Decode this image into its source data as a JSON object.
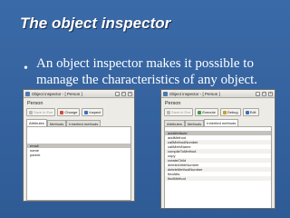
{
  "slide": {
    "title": "The object inspector",
    "bullet": "An object inspector makes it possible to manage the characteristics of any object.",
    "bullet_marker": "•"
  },
  "window1": {
    "title": "Object inspector - [ Person ]",
    "object_name": "Person",
    "toolbar": [
      {
        "label": "Save in Exe",
        "icon": "save-icon",
        "enabled": false
      },
      {
        "label": "Change",
        "icon": "change-icon",
        "enabled": true
      },
      {
        "label": "Inspect",
        "icon": "inspect-icon",
        "enabled": true
      }
    ],
    "tabs": [
      {
        "label": "Attributes",
        "active": true
      },
      {
        "label": "Methods",
        "active": false
      },
      {
        "label": "Inherited methods",
        "active": false
      }
    ],
    "attributes": [
      {
        "name": "email",
        "selected": true
      },
      {
        "name": "name",
        "selected": false
      },
      {
        "name": "parent",
        "selected": false
      }
    ]
  },
  "window2": {
    "title": "Object inspector - [ Person ]",
    "object_name": "Person",
    "toolbar": [
      {
        "label": "Save in Exe",
        "icon": "save-icon",
        "enabled": false
      },
      {
        "label": "Execute",
        "icon": "execute-icon",
        "enabled": true
      },
      {
        "label": "Debug",
        "icon": "debug-icon",
        "enabled": true
      },
      {
        "label": "Edit",
        "icon": "edit-icon",
        "enabled": true
      }
    ],
    "tabs": [
      {
        "label": "Attributes",
        "active": false
      },
      {
        "label": "Methods",
        "active": false
      },
      {
        "label": "Inherited methods",
        "active": true
      }
    ],
    "methods": [
      "addAttribute",
      "addMethod",
      "callMethodNumber",
      "callMethName",
      "compileToMethod",
      "copy",
      "createChild",
      "deleteAttribNumber",
      "deleteMethodNumber",
      "findAtts",
      "findMethod"
    ],
    "selected_method": "addAttribute"
  },
  "colors": {
    "slide_bg": "#34619c",
    "text": "#ffffff",
    "window_bg": "#ecebe6",
    "selection": "#c4c2bd"
  }
}
